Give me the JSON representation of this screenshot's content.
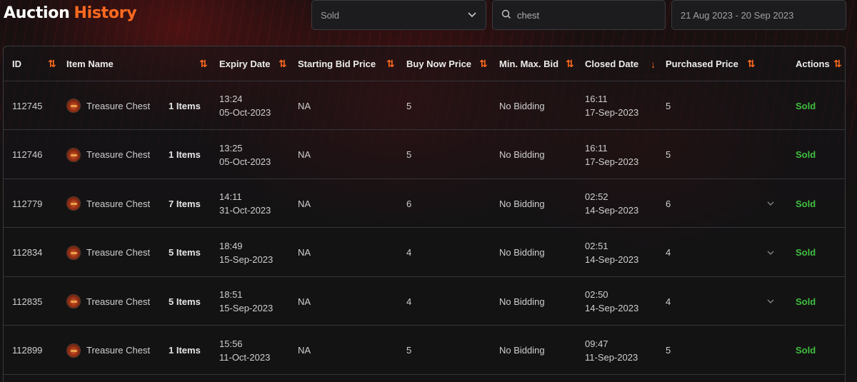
{
  "header": {
    "title_word1": "Auction",
    "title_word2": "History",
    "accent_color": "#ff6a1f"
  },
  "filters": {
    "status_value": "Sold",
    "search_value": "chest",
    "date_range": "21 Aug 2023 - 20 Sep 2023"
  },
  "table": {
    "columns": {
      "id": "ID",
      "item_name": "Item Name",
      "expiry_date": "Expiry Date",
      "starting_bid": "Starting Bid Price",
      "buy_now": "Buy Now Price",
      "min_max_bid": "Min. Max. Bid",
      "closed_date": "Closed Date",
      "purchased_price": "Purchased Price",
      "actions": "Actions"
    },
    "rows": [
      {
        "id": "112745",
        "item": "Treasure Chest",
        "qty": "1 Items",
        "exp_time": "13:24",
        "exp_date": "05-Oct-2023",
        "start_bid": "NA",
        "buy_now": "5",
        "min_max": "No Bidding",
        "closed_time": "16:11",
        "closed_date": "17-Sep-2023",
        "purchased": "5",
        "status": "Sold",
        "expandable": false
      },
      {
        "id": "112746",
        "item": "Treasure Chest",
        "qty": "1 Items",
        "exp_time": "13:25",
        "exp_date": "05-Oct-2023",
        "start_bid": "NA",
        "buy_now": "5",
        "min_max": "No Bidding",
        "closed_time": "16:11",
        "closed_date": "17-Sep-2023",
        "purchased": "5",
        "status": "Sold",
        "expandable": false
      },
      {
        "id": "112779",
        "item": "Treasure Chest",
        "qty": "7 Items",
        "exp_time": "14:11",
        "exp_date": "31-Oct-2023",
        "start_bid": "NA",
        "buy_now": "6",
        "min_max": "No Bidding",
        "closed_time": "02:52",
        "closed_date": "14-Sep-2023",
        "purchased": "6",
        "status": "Sold",
        "expandable": true
      },
      {
        "id": "112834",
        "item": "Treasure Chest",
        "qty": "5 Items",
        "exp_time": "18:49",
        "exp_date": "15-Sep-2023",
        "start_bid": "NA",
        "buy_now": "4",
        "min_max": "No Bidding",
        "closed_time": "02:51",
        "closed_date": "14-Sep-2023",
        "purchased": "4",
        "status": "Sold",
        "expandable": true
      },
      {
        "id": "112835",
        "item": "Treasure Chest",
        "qty": "5 Items",
        "exp_time": "18:51",
        "exp_date": "15-Sep-2023",
        "start_bid": "NA",
        "buy_now": "4",
        "min_max": "No Bidding",
        "closed_time": "02:50",
        "closed_date": "14-Sep-2023",
        "purchased": "4",
        "status": "Sold",
        "expandable": true
      },
      {
        "id": "112899",
        "item": "Treasure Chest",
        "qty": "1 Items",
        "exp_time": "15:56",
        "exp_date": "11-Oct-2023",
        "start_bid": "NA",
        "buy_now": "5",
        "min_max": "No Bidding",
        "closed_time": "09:47",
        "closed_date": "11-Sep-2023",
        "purchased": "5",
        "status": "Sold",
        "expandable": false
      }
    ]
  },
  "icons": {
    "sort": "sort-arrows-icon",
    "sort_down": "arrow-down-icon",
    "chevron": "chevron-down-icon",
    "search": "search-icon",
    "item": "treasure-chest-icon"
  },
  "colors": {
    "sold": "#3fbf3f"
  }
}
